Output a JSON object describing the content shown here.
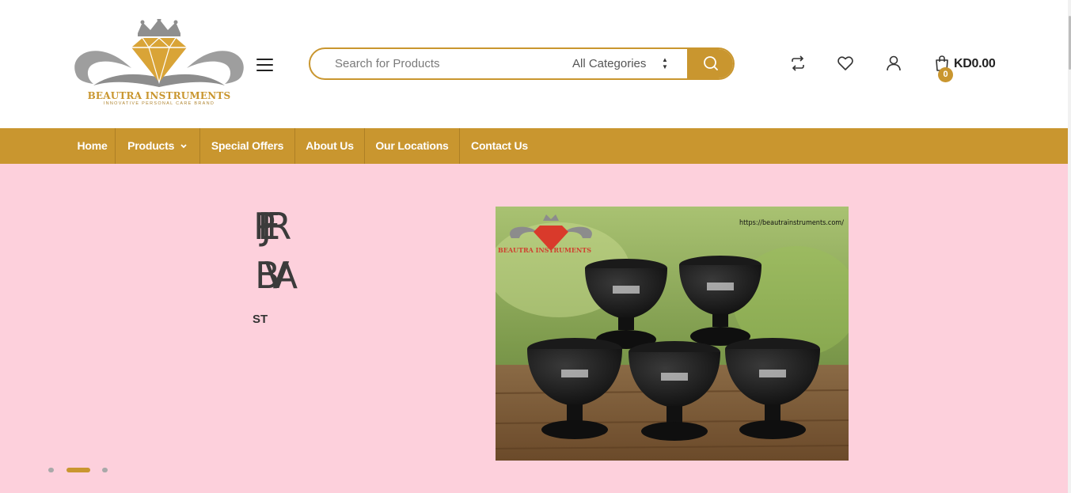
{
  "brand": {
    "name": "BEAUTRA INSTRUMENTS",
    "tagline": "INNOVATIVE PERSONAL CARE BRAND",
    "accent_color": "#c9962f",
    "hero_bg_color": "#fdd0dc"
  },
  "search": {
    "placeholder": "Search for Products",
    "category_selected": "All Categories"
  },
  "header_icons": [
    "compare-icon",
    "heart-icon",
    "user-icon",
    "shopping-bag-icon"
  ],
  "cart": {
    "count": "0",
    "total": "KD0.00"
  },
  "nav": {
    "items": [
      {
        "label": "Home"
      },
      {
        "label": "Products"
      },
      {
        "label": "Special Offers"
      },
      {
        "label": "About Us"
      },
      {
        "label": "Our Locations"
      },
      {
        "label": "Contact Us"
      }
    ]
  },
  "hero": {
    "line1": "PJER",
    "line2": "BVA",
    "subtitle": "ST",
    "image_url_text": "https://beautrainstruments.com/",
    "image_logo_text": "BEAUTRA INSTRUMENTS",
    "slide_count": 3,
    "active_slide": 2
  }
}
